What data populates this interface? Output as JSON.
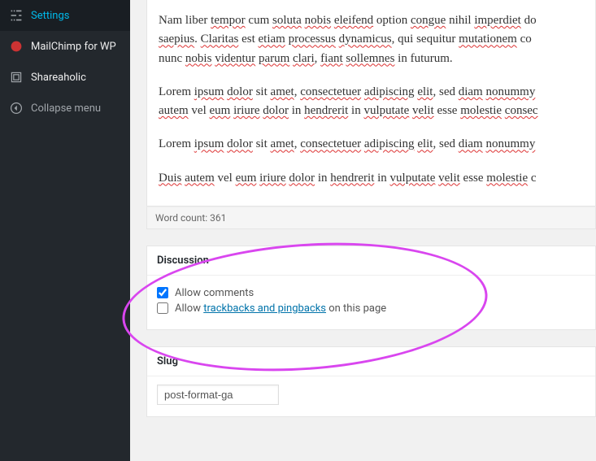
{
  "sidebar": {
    "items": [
      {
        "label": "Settings",
        "icon": "settings"
      },
      {
        "label": "MailChimp for WP",
        "icon": "mailchimp"
      },
      {
        "label": "Shareaholic",
        "icon": "shareaholic"
      },
      {
        "label": "Collapse menu",
        "icon": "collapse"
      }
    ]
  },
  "editor": {
    "paragraphs": [
      [
        {
          "t": "Nam liber "
        },
        {
          "t": "tempor",
          "sp": true
        },
        {
          "t": " cum "
        },
        {
          "t": "soluta",
          "sp": true
        },
        {
          "t": " "
        },
        {
          "t": "nobis",
          "sp": true
        },
        {
          "t": " "
        },
        {
          "t": "eleifend",
          "sp": true
        },
        {
          "t": " option "
        },
        {
          "t": "congue",
          "sp": true
        },
        {
          "t": " nihil "
        },
        {
          "t": "imperdiet",
          "sp": true
        },
        {
          "t": " do"
        }
      ],
      [
        {
          "t": "saepius",
          "sp": true
        },
        {
          "t": ". "
        },
        {
          "t": "Claritas",
          "sp": true
        },
        {
          "t": " est "
        },
        {
          "t": "etiam",
          "sp": true
        },
        {
          "t": " "
        },
        {
          "t": "processus",
          "sp": true
        },
        {
          "t": " "
        },
        {
          "t": "dynamicus",
          "sp": true
        },
        {
          "t": ", qui sequitur "
        },
        {
          "t": "mutationem",
          "sp": true
        },
        {
          "t": " co"
        }
      ],
      [
        {
          "t": "nunc "
        },
        {
          "t": "nobis",
          "sp": true
        },
        {
          "t": " "
        },
        {
          "t": "videntur",
          "sp": true
        },
        {
          "t": " "
        },
        {
          "t": "parum",
          "sp": true
        },
        {
          "t": " "
        },
        {
          "t": "clari",
          "sp": true
        },
        {
          "t": ", "
        },
        {
          "t": "fiant",
          "sp": true
        },
        {
          "t": " "
        },
        {
          "t": "sollemnes",
          "sp": true
        },
        {
          "t": " in futurum."
        }
      ],
      [
        {
          "t": "Lorem "
        },
        {
          "t": "ipsum",
          "sp": true
        },
        {
          "t": " "
        },
        {
          "t": "dolor",
          "sp": true
        },
        {
          "t": " sit "
        },
        {
          "t": "amet",
          "sp": true
        },
        {
          "t": ", "
        },
        {
          "t": "consectetuer",
          "sp": true
        },
        {
          "t": " "
        },
        {
          "t": "adipiscing",
          "sp": true
        },
        {
          "t": " "
        },
        {
          "t": "elit",
          "sp": true
        },
        {
          "t": ", sed "
        },
        {
          "t": "diam",
          "sp": true
        },
        {
          "t": " "
        },
        {
          "t": "nonummy",
          "sp": true
        }
      ],
      [
        {
          "t": "autem",
          "sp": true
        },
        {
          "t": " vel "
        },
        {
          "t": "eum",
          "sp": true
        },
        {
          "t": " "
        },
        {
          "t": "iriure",
          "sp": true
        },
        {
          "t": " "
        },
        {
          "t": "dolor",
          "sp": true
        },
        {
          "t": " in "
        },
        {
          "t": "hendrerit",
          "sp": true
        },
        {
          "t": " in "
        },
        {
          "t": "vulputate",
          "sp": true
        },
        {
          "t": " "
        },
        {
          "t": "velit",
          "sp": true
        },
        {
          "t": " esse "
        },
        {
          "t": "molestie",
          "sp": true
        },
        {
          "t": " "
        },
        {
          "t": "consec",
          "sp": true
        }
      ],
      [
        {
          "t": "Lorem "
        },
        {
          "t": "ipsum",
          "sp": true
        },
        {
          "t": " "
        },
        {
          "t": "dolor",
          "sp": true
        },
        {
          "t": " sit "
        },
        {
          "t": "amet",
          "sp": true
        },
        {
          "t": ", "
        },
        {
          "t": "consectetuer",
          "sp": true
        },
        {
          "t": " "
        },
        {
          "t": "adipiscing",
          "sp": true
        },
        {
          "t": " "
        },
        {
          "t": "elit",
          "sp": true
        },
        {
          "t": ", sed "
        },
        {
          "t": "diam",
          "sp": true
        },
        {
          "t": " "
        },
        {
          "t": "nonummy",
          "sp": true
        }
      ],
      [
        {
          "t": "Duis",
          "sp": true
        },
        {
          "t": " "
        },
        {
          "t": "autem",
          "sp": true
        },
        {
          "t": " vel "
        },
        {
          "t": "eum",
          "sp": true
        },
        {
          "t": " "
        },
        {
          "t": "iriure",
          "sp": true
        },
        {
          "t": " "
        },
        {
          "t": "dolor",
          "sp": true
        },
        {
          "t": " in "
        },
        {
          "t": "hendrerit",
          "sp": true
        },
        {
          "t": " in "
        },
        {
          "t": "vulputate",
          "sp": true
        },
        {
          "t": " "
        },
        {
          "t": "velit",
          "sp": true
        },
        {
          "t": " esse "
        },
        {
          "t": "molestie",
          "sp": true
        },
        {
          "t": " c"
        }
      ]
    ],
    "paragraph_groups": [
      [
        0,
        1,
        2
      ],
      [
        3,
        4
      ],
      [
        5
      ],
      [
        6
      ]
    ],
    "wordcount_label": "Word count: 361"
  },
  "discussion": {
    "title": "Discussion",
    "allow_comments_label": "Allow comments",
    "allow_comments_checked": true,
    "allow_trackbacks_prefix": "Allow ",
    "allow_trackbacks_link": "trackbacks and pingbacks",
    "allow_trackbacks_suffix": " on this page",
    "allow_trackbacks_checked": false
  },
  "slug": {
    "title": "Slug",
    "value": "post-format-ga"
  }
}
